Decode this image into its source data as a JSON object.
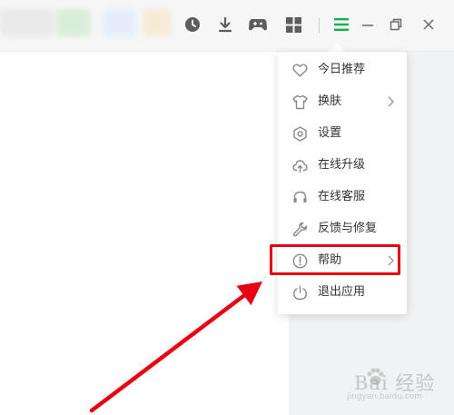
{
  "toolbar": {
    "icons": [
      "history-icon",
      "download-icon",
      "gamepad-icon",
      "apps-grid-icon",
      "menu-icon",
      "minimize-icon",
      "restore-icon",
      "close-icon"
    ],
    "accent": "#12b24e"
  },
  "menu": {
    "items": [
      {
        "label": "今日推荐",
        "icon": "heart-icon",
        "has_submenu": false
      },
      {
        "label": "换肤",
        "icon": "tshirt-icon",
        "has_submenu": true
      },
      {
        "label": "设置",
        "icon": "settings-icon",
        "has_submenu": false
      },
      {
        "label": "在线升级",
        "icon": "cloud-upload-icon",
        "has_submenu": false
      },
      {
        "label": "在线客服",
        "icon": "headset-icon",
        "has_submenu": false
      },
      {
        "label": "反馈与修复",
        "icon": "wrench-icon",
        "has_submenu": false
      },
      {
        "label": "帮助",
        "icon": "help-circle-icon",
        "has_submenu": true
      },
      {
        "label": "退出应用",
        "icon": "power-icon",
        "has_submenu": false
      }
    ]
  },
  "annotation": {
    "highlight_color": "#e60012",
    "highlight_target": "帮助"
  },
  "watermark": {
    "text": "Bai 经验",
    "url": "jingyan.baidu.com"
  }
}
